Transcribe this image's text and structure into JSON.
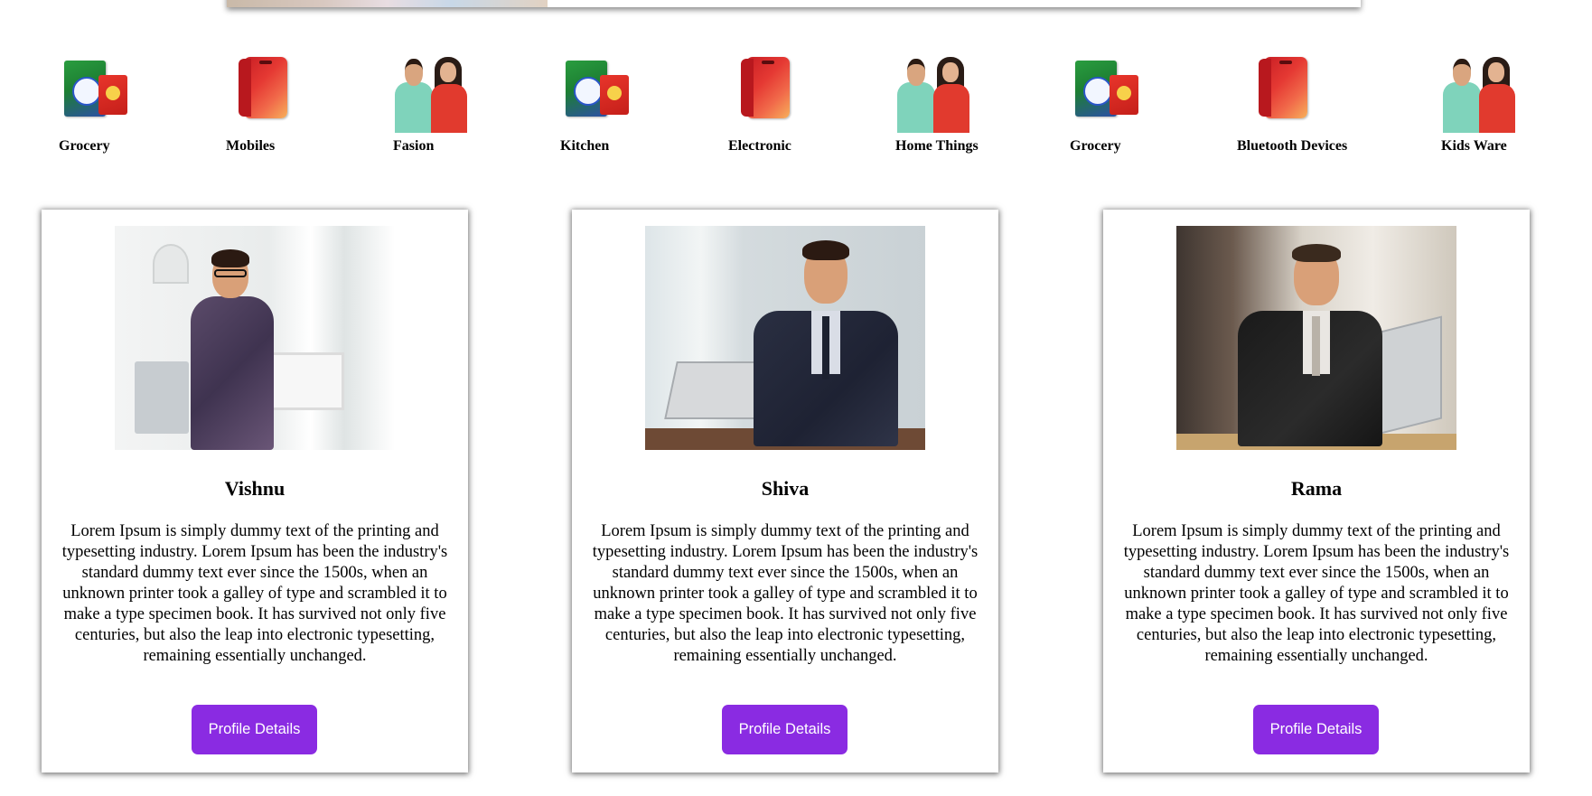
{
  "categories": [
    {
      "label": "Grocery",
      "icon": "grocery-pack-icon"
    },
    {
      "label": "Mobiles",
      "icon": "mobile-phone-icon"
    },
    {
      "label": "Fasion",
      "icon": "fashion-couple-icon"
    },
    {
      "label": "Kitchen",
      "icon": "grocery-pack-icon"
    },
    {
      "label": "Electronic",
      "icon": "mobile-phone-icon"
    },
    {
      "label": "Home Things",
      "icon": "fashion-couple-icon"
    },
    {
      "label": "Grocery",
      "icon": "grocery-pack-icon"
    },
    {
      "label": "Bluetooth Devices",
      "icon": "mobile-phone-icon"
    },
    {
      "label": "Kids Ware",
      "icon": "fashion-couple-icon"
    }
  ],
  "profiles": [
    {
      "name": "Vishnu",
      "description": "Lorem Ipsum is simply dummy text of the printing and typesetting industry. Lorem Ipsum has been the industry's standard dummy text ever since the 1500s, when an unknown printer took a galley of type and scrambled it to make a type specimen book. It has survived not only five centuries, but also the leap into electronic typesetting, remaining essentially unchanged.",
      "button_label": "Profile Details"
    },
    {
      "name": "Shiva",
      "description": "Lorem Ipsum is simply dummy text of the printing and typesetting industry. Lorem Ipsum has been the industry's standard dummy text ever since the 1500s, when an unknown printer took a galley of type and scrambled it to make a type specimen book. It has survived not only five centuries, but also the leap into electronic typesetting, remaining essentially unchanged.",
      "button_label": "Profile Details"
    },
    {
      "name": "Rama",
      "description": "Lorem Ipsum is simply dummy text of the printing and typesetting industry. Lorem Ipsum has been the industry's standard dummy text ever since the 1500s, when an unknown printer took a galley of type and scrambled it to make a type specimen book. It has survived not only five centuries, but also the leap into electronic typesetting, remaining essentially unchanged.",
      "button_label": "Profile Details"
    }
  ],
  "colors": {
    "accent": "#8a2be2",
    "button_text": "#ffffff",
    "background": "#ffffff"
  }
}
